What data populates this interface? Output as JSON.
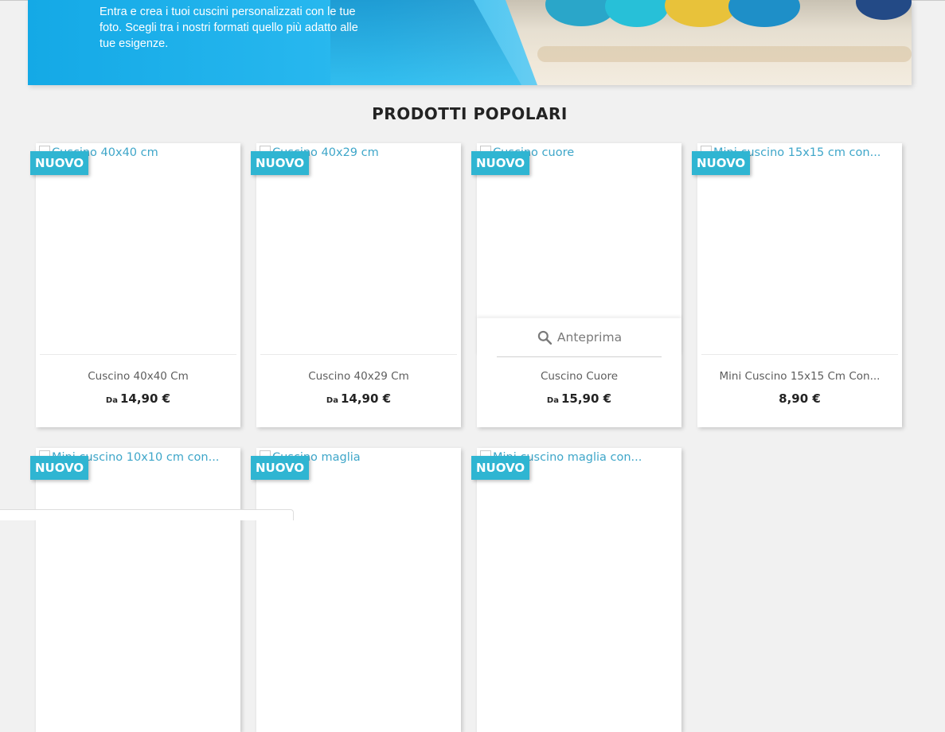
{
  "banner": {
    "text": "Entra e crea i tuoi cuscini personalizzati con le tue foto. Scegli tra i nostri formati quello più adatto alle tue esigenze."
  },
  "section": {
    "title": "PRODOTTI POPOLARI"
  },
  "colors": {
    "badge": "#2fb5d2",
    "link": "#3ea6c9",
    "background": "#f1f1f1"
  },
  "products": [
    {
      "alt": "Cuscino 40x40 cm",
      "badge": "NUOVO",
      "name": "Cuscino 40x40 Cm",
      "from": "Da",
      "price": "14,90 €"
    },
    {
      "alt": "Cuscino 40x29 cm",
      "badge": "NUOVO",
      "name": "Cuscino 40x29 Cm",
      "from": "Da",
      "price": "14,90 €"
    },
    {
      "alt": "Cuscino cuore",
      "badge": "NUOVO",
      "name": "Cuscino Cuore",
      "from": "Da",
      "price": "15,90 €",
      "quickview": "Anteprima",
      "quickview_icon": "search-icon"
    },
    {
      "alt": "Mini cuscino 15x15 cm con...",
      "badge": "NUOVO",
      "name": "Mini Cuscino 15x15 Cm Con...",
      "price": "8,90 €"
    },
    {
      "alt": "Mini cuscino 10x10 cm con...",
      "badge": "NUOVO"
    },
    {
      "alt": "Cuscino maglia",
      "badge": "NUOVO"
    },
    {
      "alt": "Mini cuscino maglia con...",
      "badge": "NUOVO"
    }
  ]
}
